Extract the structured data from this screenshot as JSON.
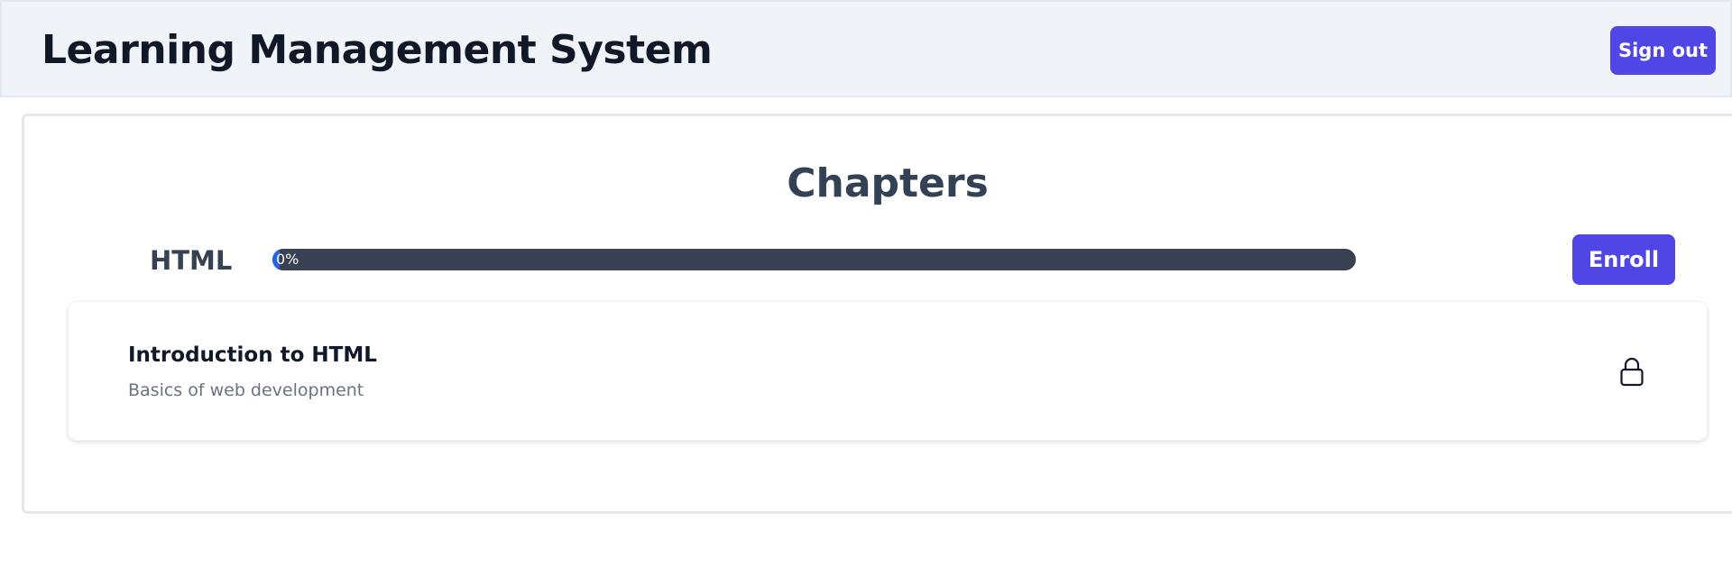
{
  "header": {
    "title": "Learning Management System",
    "signout_label": "Sign out"
  },
  "main": {
    "heading": "Chapters",
    "course": {
      "name": "HTML",
      "progress_percent": 0,
      "progress_text": "0%",
      "enroll_label": "Enroll"
    },
    "chapters": [
      {
        "title": "Introduction to HTML",
        "description": "Basics of web development",
        "icon": "lock-icon",
        "locked": true
      }
    ]
  },
  "colors": {
    "accent": "#4f46e5",
    "header_bg": "#f0f3f8",
    "progress_track": "#374151",
    "progress_fill": "#2563eb"
  }
}
